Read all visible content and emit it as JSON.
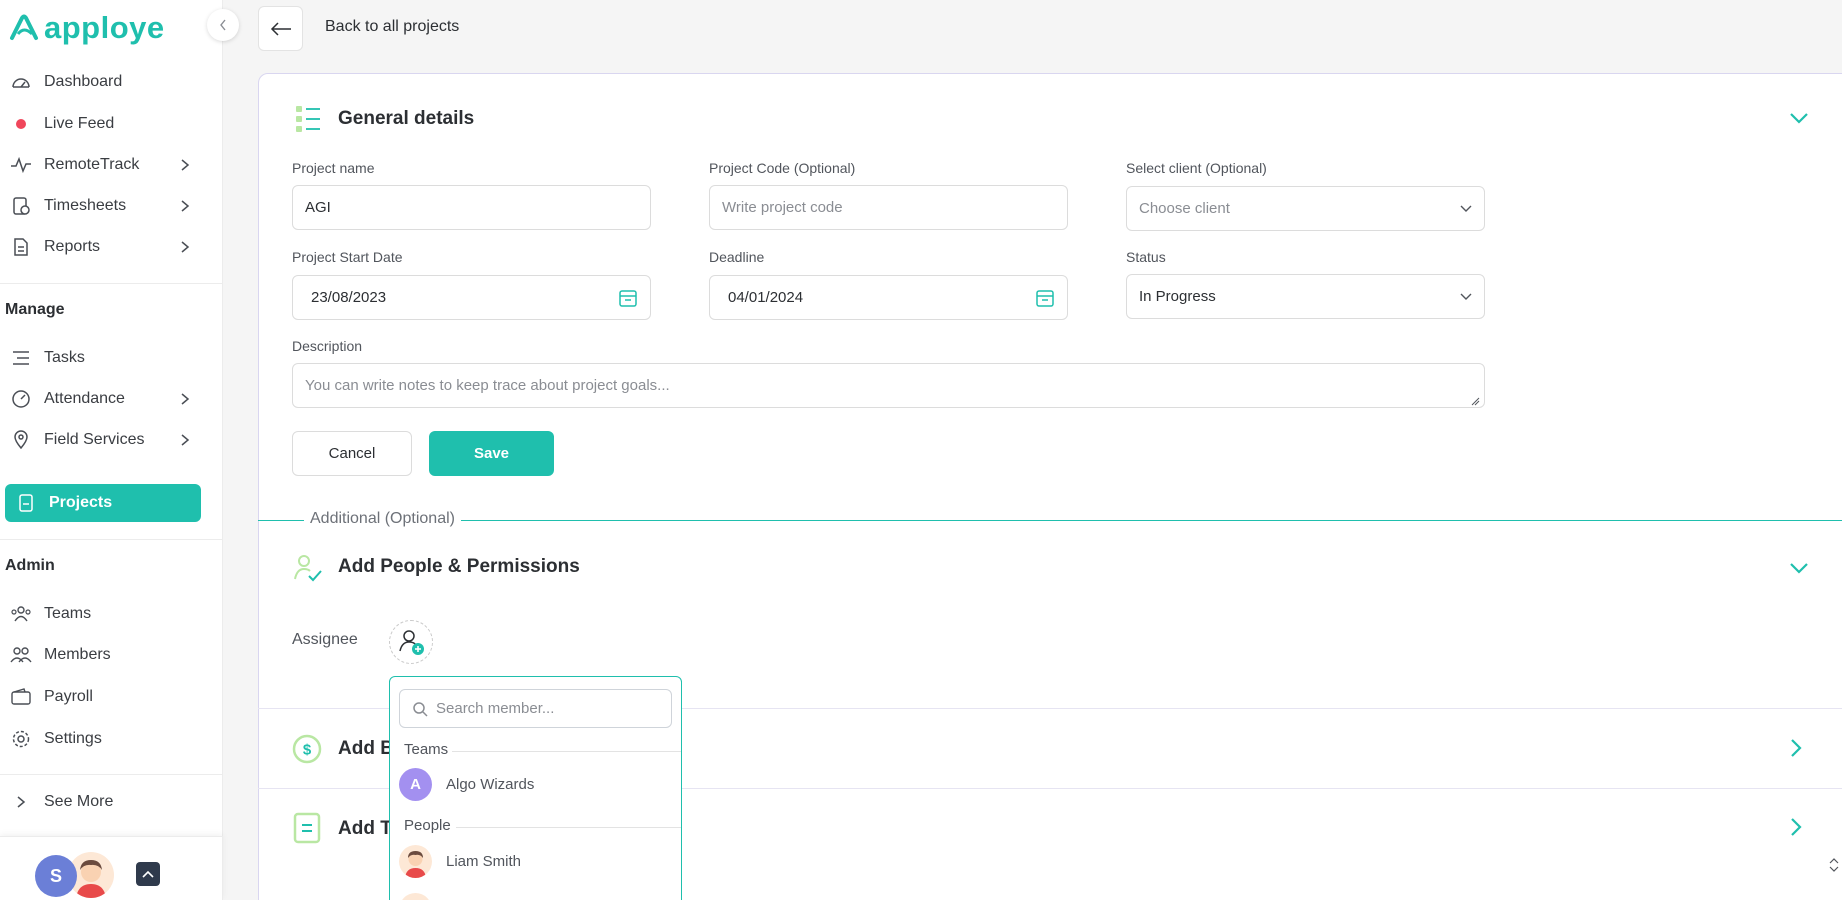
{
  "app": {
    "logo_text": "apploye"
  },
  "topbar": {
    "back_label": "Back to all projects"
  },
  "sidebar": {
    "items": [
      {
        "label": "Dashboard"
      },
      {
        "label": "Live Feed"
      },
      {
        "label": "RemoteTrack"
      },
      {
        "label": "Timesheets"
      },
      {
        "label": "Reports"
      }
    ],
    "manage_label": "Manage",
    "manage_items": [
      {
        "label": "Tasks"
      },
      {
        "label": "Attendance"
      },
      {
        "label": "Field Services"
      },
      {
        "label": "Projects"
      }
    ],
    "admin_label": "Admin",
    "admin_items": [
      {
        "label": "Teams"
      },
      {
        "label": "Members"
      },
      {
        "label": "Payroll"
      },
      {
        "label": "Settings"
      }
    ],
    "see_more": "See More",
    "user_initial": "S"
  },
  "general": {
    "title": "General details",
    "project_name_label": "Project name",
    "project_name_value": "AGI",
    "project_code_label": "Project Code (Optional)",
    "project_code_placeholder": "Write project code",
    "client_label": "Select client (Optional)",
    "client_placeholder": "Choose client",
    "start_label": "Project Start Date",
    "start_value": "23/08/2023",
    "deadline_label": "Deadline",
    "deadline_value": "04/01/2024",
    "status_label": "Status",
    "status_value": "In Progress",
    "description_label": "Description",
    "description_placeholder": "You can write notes to keep trace about project goals...",
    "cancel_label": "Cancel",
    "save_label": "Save"
  },
  "additional_label": "Additional (Optional)",
  "people": {
    "title": "Add People & Permissions",
    "assignee_label": "Assignee"
  },
  "budget": {
    "title_visible": "Add B"
  },
  "tasks": {
    "title_visible": "Add T"
  },
  "dropdown": {
    "search_placeholder": "Search member...",
    "teams_label": "Teams",
    "teams": [
      {
        "initial": "A",
        "name": "Algo Wizards",
        "color": "#a390f0"
      }
    ],
    "people_label": "People",
    "people": [
      {
        "name": "Liam Smith"
      }
    ]
  },
  "colors": {
    "accent": "#1fbfad",
    "live": "#f0465b"
  }
}
